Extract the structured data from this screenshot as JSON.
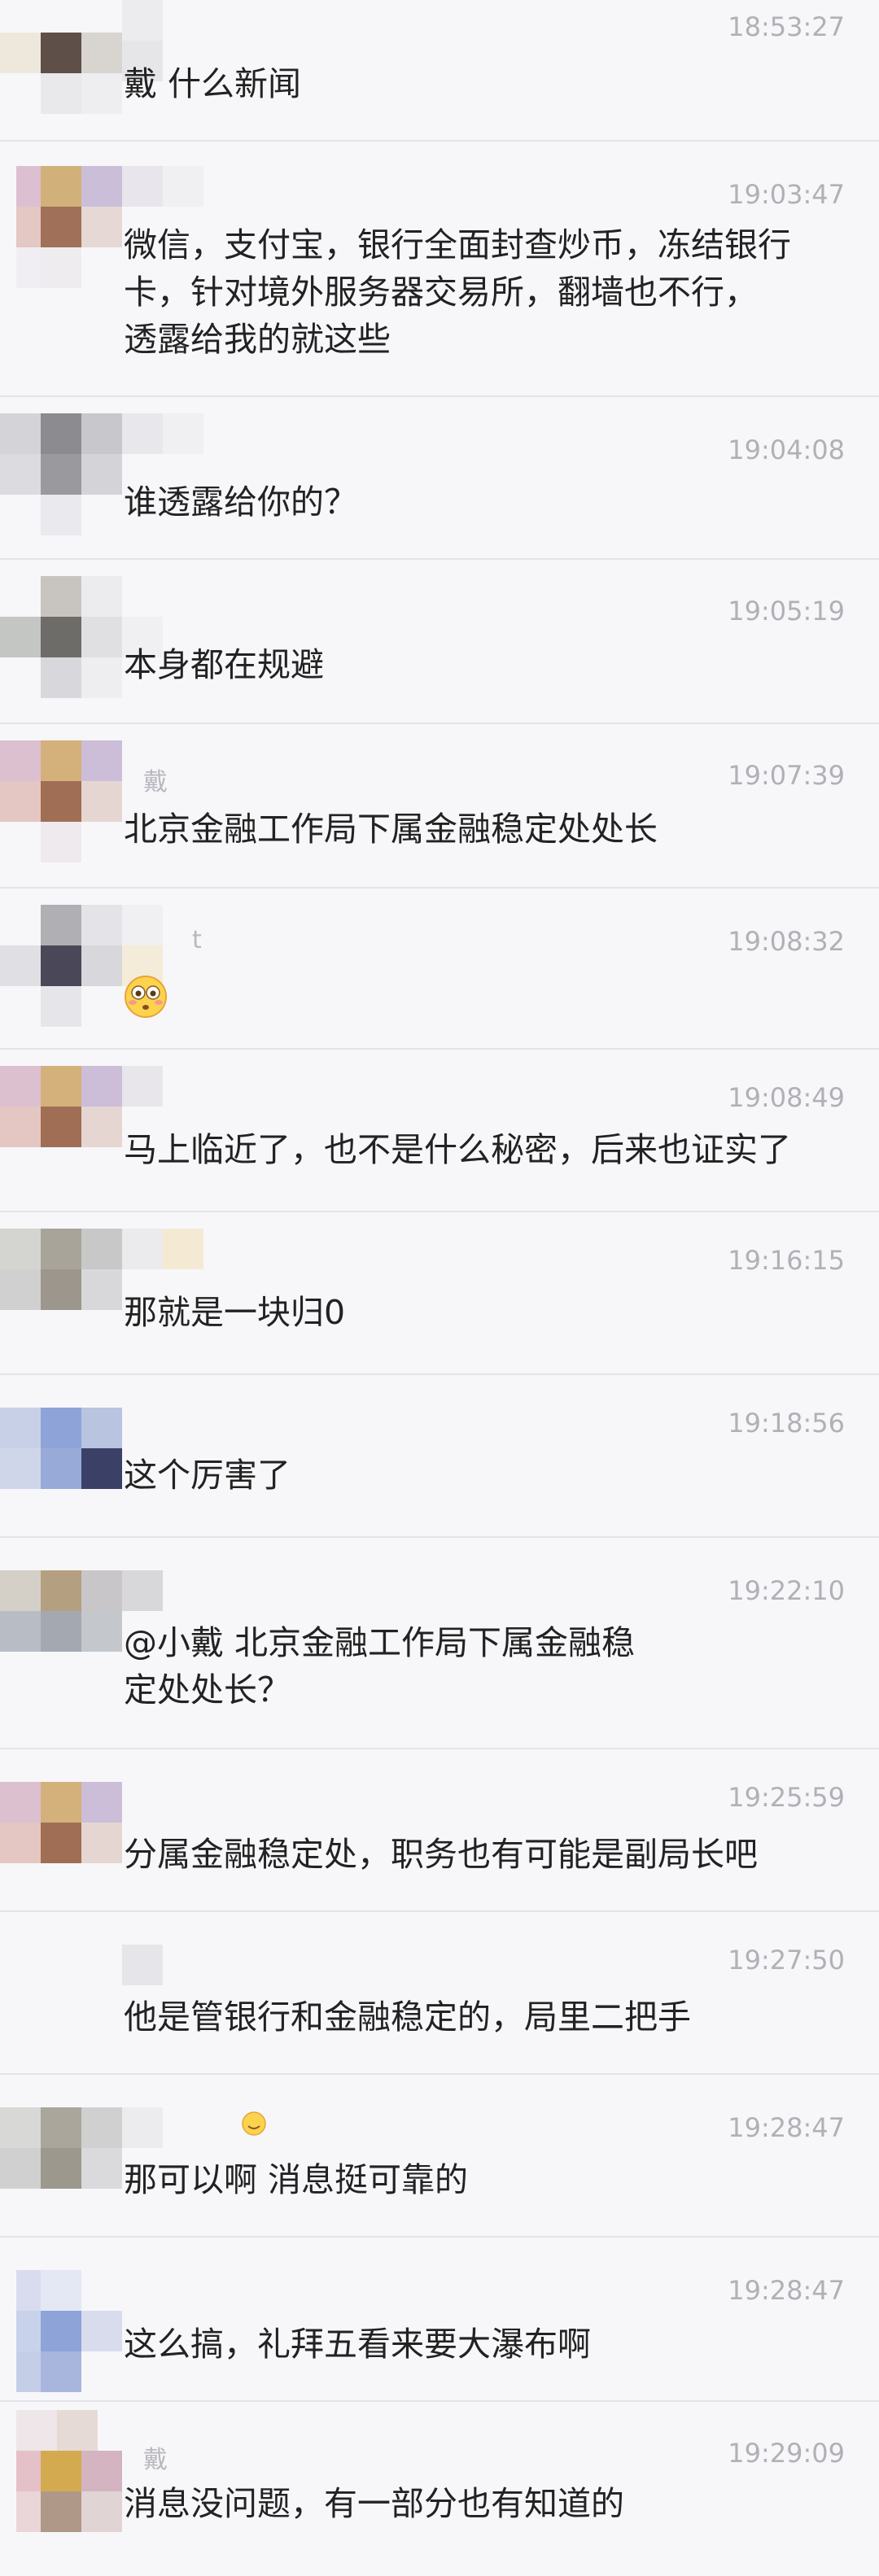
{
  "messages": [
    {
      "time": "18:53:27",
      "text": "戴 什么新闻",
      "name_fragment": "",
      "emoji": ""
    },
    {
      "time": "19:03:47",
      "text": "微信，支付宝，银行全面封查炒币，冻结银行\n卡，针对境外服务器交易所，翻墙也不行，\n透露给我的就这些",
      "name_fragment": "",
      "emoji": ""
    },
    {
      "time": "19:04:08",
      "text": "谁透露给你的？",
      "name_fragment": "",
      "emoji": ""
    },
    {
      "time": "19:05:19",
      "text": "本身都在规避",
      "name_fragment": "",
      "emoji": ""
    },
    {
      "time": "19:07:39",
      "text": "北京金融工作局下属金融稳定处处长",
      "name_fragment": "戴",
      "emoji": ""
    },
    {
      "time": "19:08:32",
      "text": "",
      "name_fragment": "t",
      "emoji": "flushed-face"
    },
    {
      "time": "19:08:49",
      "text": "马上临近了，也不是什么秘密，后来也证实了",
      "name_fragment": "",
      "emoji": ""
    },
    {
      "time": "19:16:15",
      "text": "那就是一块归0",
      "name_fragment": "",
      "emoji": ""
    },
    {
      "time": "19:18:56",
      "text": "这个厉害了",
      "name_fragment": "",
      "emoji": ""
    },
    {
      "time": "19:22:10",
      "text": "@小戴 北京金融工作局下属金融稳\n定处处长？",
      "name_fragment": "",
      "emoji": ""
    },
    {
      "time": "19:25:59",
      "text": "分属金融稳定处，职务也有可能是副局长吧",
      "name_fragment": "",
      "emoji": ""
    },
    {
      "time": "19:27:50",
      "text": "他是管银行和金融稳定的，局里二把手",
      "name_fragment": "",
      "emoji": ""
    },
    {
      "time": "19:28:47",
      "text": "那可以啊 消息挺可靠的",
      "name_fragment": "",
      "emoji": ""
    },
    {
      "time": "19:28:47",
      "text": "这么搞，礼拜五看来要大瀑布啊",
      "name_fragment": "",
      "emoji": ""
    },
    {
      "time": "19:29:09",
      "text": "消息没问题，有一部分也有知道的",
      "name_fragment": "戴",
      "emoji": ""
    }
  ]
}
